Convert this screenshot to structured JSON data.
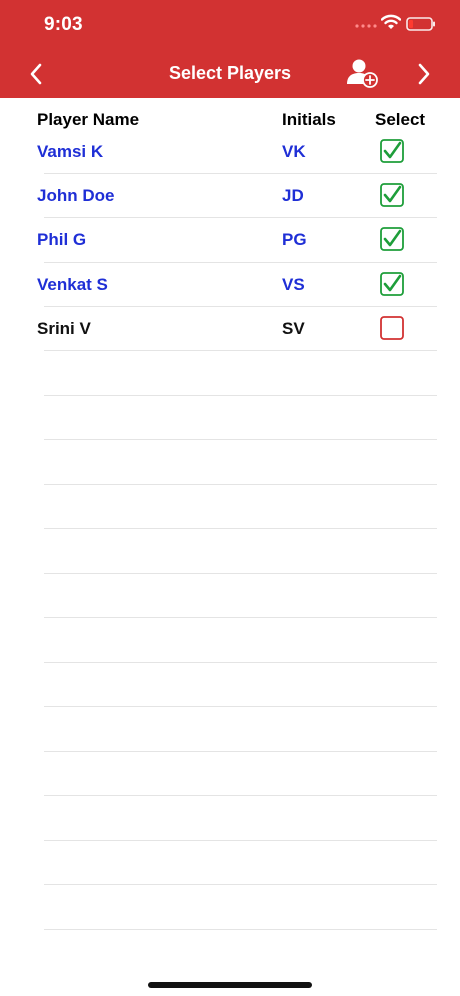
{
  "status_bar": {
    "time": "9:03"
  },
  "nav": {
    "title": "Select Players",
    "back_icon": "chevron-left-icon",
    "next_icon": "chevron-right-icon",
    "add_player_icon": "add-user-icon"
  },
  "columns": {
    "name": "Player Name",
    "initials": "Initials",
    "select": "Select"
  },
  "players": [
    {
      "name": "Vamsi K",
      "initials": "VK",
      "selected": true
    },
    {
      "name": "John Doe",
      "initials": "JD",
      "selected": true
    },
    {
      "name": "Phil G",
      "initials": "PG",
      "selected": true
    },
    {
      "name": "Venkat S",
      "initials": "VS",
      "selected": true
    },
    {
      "name": "Srini V",
      "initials": "SV",
      "selected": false
    }
  ],
  "colors": {
    "header_bg": "#d23232",
    "selected_text": "#1f2fd6",
    "unselected_text": "#111111",
    "check_green": "#1e9e3a",
    "check_red": "#d23232"
  }
}
